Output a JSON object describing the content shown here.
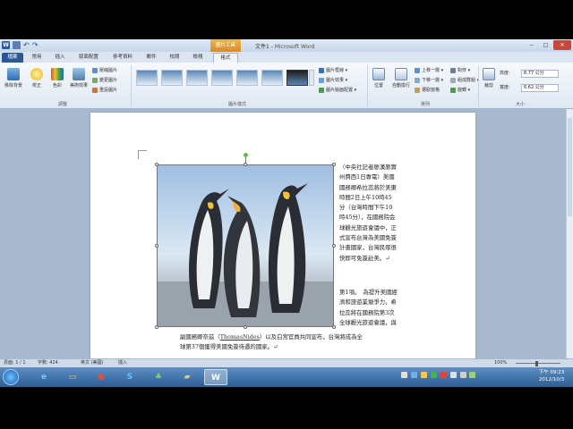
{
  "window": {
    "title_prefix": "文件1 -",
    "title_app": "Microsoft Word",
    "context_tab": "圖片工具",
    "minimize": "−",
    "maximize": "□",
    "close": "✕"
  },
  "quick_access": {
    "word_logo": "W",
    "undo": "↶",
    "redo": "↷"
  },
  "tabs": [
    {
      "label": "檔案"
    },
    {
      "label": "常用"
    },
    {
      "label": "插入"
    },
    {
      "label": "版面配置"
    },
    {
      "label": "參考資料"
    },
    {
      "label": "郵件"
    },
    {
      "label": "校閱"
    },
    {
      "label": "檢視"
    },
    {
      "label": "格式"
    }
  ],
  "ribbon": {
    "adjust": {
      "remove_bg": "移除背景",
      "corrections": "校正",
      "color": "色彩",
      "artistic": "美術效果",
      "compress": "壓縮圖片",
      "change": "變更圖片",
      "reset": "重設圖片",
      "label": "調整"
    },
    "styles": {
      "label": "圖片樣式"
    },
    "style_options": {
      "border": "圖片框線 ▾",
      "effects": "圖片效果 ▾",
      "layout": "圖片版面配置 ▾"
    },
    "arrange": {
      "position": "位置",
      "wrap": "自動換行",
      "bring_forward": "上移一層 ▾",
      "send_backward": "下移一層 ▾",
      "selection_pane": "選取窗格",
      "align": "對齊 ▾",
      "group": "組成群組 ▾",
      "rotate": "旋轉 ▾",
      "label": "排列"
    },
    "size": {
      "crop": "裁剪",
      "height_label": "高度:",
      "height_value": "8.77 公分",
      "width_label": "寬度:",
      "width_value": "6.62 公分",
      "label": "大小"
    }
  },
  "document": {
    "right_para1": [
      "（中央社記者廖漢原實",
      "州費西1日專電）美國",
      "國務卿希拉蕊將於美東",
      "時間2日上午10時45",
      "分（台灣時間下午10",
      "時45分），在國務院会",
      "球觀光旅遊會議中，正",
      "式宣布台灣為美國免簽",
      "計畫國家，台灣民眾很",
      "快即可免簽赴美。↵"
    ],
    "right_para2": [
      "第1項。　為提升美國經",
      "濟和旅遊業競爭力，希",
      "拉蕊將在國務院第3次",
      "全球觀光旅遊會議，與"
    ],
    "bottom_line1_pre": "副國務卿奈茲（",
    "bottom_line1_name": "ThomasNides",
    "bottom_line1_post": "）以及白宮官員共同宣布，台灣將成為全",
    "bottom_line2": "球第37個獲得美國免簽待遇的國家。↵"
  },
  "status": {
    "page": "頁面: 1 / 1",
    "words": "字數: 424",
    "lang": "英文 (美國)",
    "mode": "插入",
    "zoom": "100%"
  },
  "taskbar": {
    "apps": [
      {
        "name": "ie",
        "glyph": "e",
        "color": "#2e86d6"
      },
      {
        "name": "explorer",
        "glyph": "▭",
        "color": "#e8c45a"
      },
      {
        "name": "chrome",
        "glyph": "●",
        "color": "#d94a3a"
      },
      {
        "name": "skype",
        "glyph": "S",
        "color": "#1aa3e8"
      },
      {
        "name": "app-green",
        "glyph": "♣",
        "color": "#53a844"
      },
      {
        "name": "app-folder",
        "glyph": "▰",
        "color": "#c9b16a"
      },
      {
        "name": "word",
        "glyph": "W",
        "color": "#2b5797"
      }
    ],
    "time": "下午 09:23",
    "date": "2012/10/3"
  }
}
